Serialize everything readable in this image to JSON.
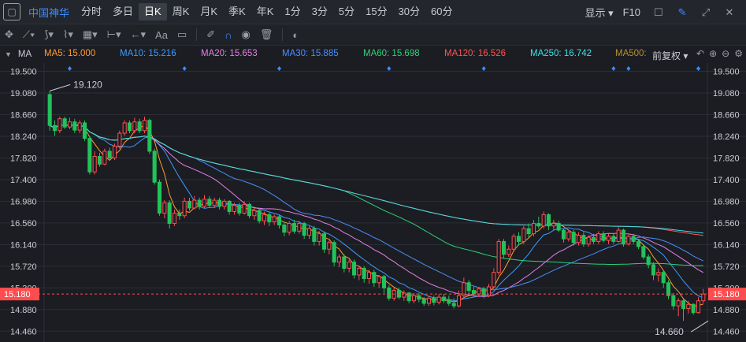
{
  "toolbar": {
    "back_icon": "square-back-icon",
    "stock_name": "中国神华",
    "periods": [
      {
        "label": "分时",
        "active": false
      },
      {
        "label": "多日",
        "active": false
      },
      {
        "label": "日K",
        "active": true
      },
      {
        "label": "周K",
        "active": false
      },
      {
        "label": "月K",
        "active": false
      },
      {
        "label": "季K",
        "active": false
      },
      {
        "label": "年K",
        "active": false
      },
      {
        "label": "1分",
        "active": false
      },
      {
        "label": "3分",
        "active": false
      },
      {
        "label": "5分",
        "active": false
      },
      {
        "label": "15分",
        "active": false
      },
      {
        "label": "30分",
        "active": false
      },
      {
        "label": "60分",
        "active": false
      }
    ],
    "display_label": "显示",
    "f10_label": "F10"
  },
  "drawing_tools": {
    "text_tool": "Aa"
  },
  "legend": {
    "ma_label": "MA",
    "adjust_label": "前复权",
    "items": [
      {
        "text": "MA5: 15.000",
        "color": "#ff9b2f",
        "x": 56
      },
      {
        "text": "MA10: 15.216",
        "color": "#3d9bff",
        "x": 152
      },
      {
        "text": "MA20: 15.653",
        "color": "#e77fe6",
        "x": 255
      },
      {
        "text": "MA30: 15.885",
        "color": "#4a8dff",
        "x": 358
      },
      {
        "text": "MA60: 15.698",
        "color": "#2fd07a",
        "x": 461
      },
      {
        "text": "MA120: 16.526",
        "color": "#ff5454",
        "x": 564
      },
      {
        "text": "MA250: 16.742",
        "color": "#3de0e6",
        "x": 673
      },
      {
        "text": "MA500:",
        "color": "#b8902c",
        "x": 781
      }
    ]
  },
  "colors": {
    "up": "#ff4d4f",
    "down": "#22c25a",
    "grid": "#2b2e35",
    "axis_text": "#c9ccd2",
    "current_price_bg": "#ff4d4f"
  },
  "chart_data": {
    "type": "candlestick",
    "ylim": [
      14.25,
      19.6
    ],
    "y_ticks": [
      19.5,
      19.08,
      18.66,
      18.24,
      17.82,
      17.4,
      16.98,
      16.56,
      16.14,
      15.72,
      15.3,
      14.88,
      14.46
    ],
    "y_tick_labels": [
      "19.500",
      "19.080",
      "18.660",
      "18.240",
      "17.820",
      "17.400",
      "16.980",
      "16.560",
      "16.140",
      "15.720",
      "15.300",
      "14.880",
      "14.460"
    ],
    "current_price": 15.18,
    "current_price_label": "15.180",
    "annotations": [
      {
        "text": "19.120",
        "price": 19.12,
        "index": 0
      },
      {
        "text": "14.660",
        "price": 14.66,
        "index": 132
      }
    ],
    "candles": [
      [
        19.05,
        18.45,
        19.12,
        18.35
      ],
      [
        18.45,
        18.35,
        18.55,
        18.25
      ],
      [
        18.35,
        18.58,
        18.62,
        18.3
      ],
      [
        18.58,
        18.42,
        18.62,
        18.38
      ],
      [
        18.42,
        18.52,
        18.6,
        18.38
      ],
      [
        18.52,
        18.36,
        18.58,
        18.3
      ],
      [
        18.36,
        18.5,
        18.55,
        18.3
      ],
      [
        18.5,
        18.2,
        18.55,
        18.15
      ],
      [
        18.2,
        17.55,
        18.25,
        17.5
      ],
      [
        17.55,
        17.85,
        17.95,
        17.5
      ],
      [
        17.85,
        17.7,
        17.92,
        17.65
      ],
      [
        17.7,
        17.95,
        18.0,
        17.68
      ],
      [
        17.95,
        17.82,
        18.02,
        17.78
      ],
      [
        17.82,
        18.05,
        18.1,
        17.78
      ],
      [
        18.05,
        18.3,
        18.35,
        18.0
      ],
      [
        18.3,
        18.5,
        18.55,
        18.25
      ],
      [
        18.5,
        18.35,
        18.55,
        18.3
      ],
      [
        18.35,
        18.52,
        18.6,
        18.3
      ],
      [
        18.52,
        18.35,
        18.58,
        18.3
      ],
      [
        18.35,
        18.55,
        18.62,
        18.3
      ],
      [
        18.55,
        17.95,
        18.58,
        17.9
      ],
      [
        17.95,
        17.35,
        18.0,
        17.3
      ],
      [
        17.35,
        16.75,
        17.4,
        16.7
      ],
      [
        16.75,
        16.95,
        17.0,
        16.65
      ],
      [
        16.95,
        16.55,
        17.0,
        16.45
      ],
      [
        16.55,
        16.75,
        16.82,
        16.5
      ],
      [
        16.75,
        16.7,
        16.82,
        16.62
      ],
      [
        16.7,
        16.98,
        17.05,
        16.65
      ],
      [
        16.98,
        16.85,
        17.05,
        16.8
      ],
      [
        16.85,
        17.0,
        17.08,
        16.82
      ],
      [
        17.0,
        16.88,
        17.05,
        16.82
      ],
      [
        16.88,
        17.02,
        17.1,
        16.85
      ],
      [
        17.02,
        16.9,
        17.08,
        16.85
      ],
      [
        16.9,
        17.0,
        17.05,
        16.85
      ],
      [
        17.0,
        16.88,
        17.05,
        16.82
      ],
      [
        16.88,
        16.98,
        17.02,
        16.82
      ],
      [
        16.98,
        16.78,
        17.0,
        16.72
      ],
      [
        16.78,
        16.9,
        16.95,
        16.72
      ],
      [
        16.9,
        16.75,
        16.95,
        16.7
      ],
      [
        16.75,
        16.92,
        16.98,
        16.72
      ],
      [
        16.92,
        16.7,
        16.95,
        16.65
      ],
      [
        16.7,
        16.8,
        16.85,
        16.62
      ],
      [
        16.8,
        16.6,
        16.85,
        16.55
      ],
      [
        16.6,
        16.72,
        16.78,
        16.52
      ],
      [
        16.72,
        16.58,
        16.78,
        16.5
      ],
      [
        16.58,
        16.68,
        16.72,
        16.52
      ],
      [
        16.68,
        16.52,
        16.72,
        16.45
      ],
      [
        16.52,
        16.38,
        16.58,
        16.3
      ],
      [
        16.38,
        16.55,
        16.6,
        16.32
      ],
      [
        16.55,
        16.4,
        16.62,
        16.35
      ],
      [
        16.4,
        16.55,
        16.6,
        16.35
      ],
      [
        16.55,
        16.32,
        16.58,
        16.25
      ],
      [
        16.32,
        16.45,
        16.5,
        16.25
      ],
      [
        16.45,
        16.2,
        16.5,
        16.12
      ],
      [
        16.2,
        16.35,
        16.4,
        16.12
      ],
      [
        16.35,
        16.05,
        16.4,
        15.98
      ],
      [
        16.05,
        16.18,
        16.22,
        15.95
      ],
      [
        16.18,
        15.8,
        16.22,
        15.72
      ],
      [
        15.8,
        15.9,
        15.95,
        15.7
      ],
      [
        15.9,
        15.68,
        15.95,
        15.6
      ],
      [
        15.68,
        15.8,
        15.85,
        15.6
      ],
      [
        15.8,
        15.55,
        15.85,
        15.48
      ],
      [
        15.55,
        15.68,
        15.72,
        15.45
      ],
      [
        15.68,
        15.48,
        15.72,
        15.4
      ],
      [
        15.48,
        15.6,
        15.65,
        15.38
      ],
      [
        15.6,
        15.4,
        15.65,
        15.32
      ],
      [
        15.4,
        15.52,
        15.55,
        15.3
      ],
      [
        15.52,
        15.3,
        15.55,
        15.2
      ],
      [
        15.3,
        15.1,
        15.35,
        15.05
      ],
      [
        15.1,
        15.25,
        15.3,
        15.05
      ],
      [
        15.25,
        15.12,
        15.3,
        15.08
      ],
      [
        15.12,
        15.2,
        15.25,
        15.05
      ],
      [
        15.2,
        15.05,
        15.22,
        15.0
      ],
      [
        15.05,
        15.15,
        15.2,
        15.0
      ],
      [
        15.15,
        15.08,
        15.2,
        15.02
      ],
      [
        15.08,
        15.0,
        15.12,
        14.95
      ],
      [
        15.0,
        15.1,
        15.15,
        14.95
      ],
      [
        15.1,
        15.02,
        15.15,
        14.96
      ],
      [
        15.02,
        15.12,
        15.18,
        14.98
      ],
      [
        15.12,
        15.05,
        15.18,
        15.0
      ],
      [
        15.05,
        15.0,
        15.15,
        14.95
      ],
      [
        15.0,
        14.95,
        15.1,
        14.9
      ],
      [
        14.95,
        15.15,
        15.25,
        14.92
      ],
      [
        15.15,
        15.4,
        15.5,
        15.1
      ],
      [
        15.4,
        15.25,
        15.45,
        15.18
      ],
      [
        15.25,
        15.18,
        15.32,
        15.12
      ],
      [
        15.18,
        15.28,
        15.32,
        15.12
      ],
      [
        15.28,
        15.15,
        15.32,
        15.1
      ],
      [
        15.15,
        15.32,
        15.38,
        15.12
      ],
      [
        15.32,
        15.6,
        15.68,
        15.28
      ],
      [
        15.6,
        16.2,
        16.25,
        15.55
      ],
      [
        16.2,
        15.95,
        16.25,
        15.88
      ],
      [
        15.95,
        16.05,
        16.12,
        15.9
      ],
      [
        16.05,
        16.3,
        16.35,
        16.0
      ],
      [
        16.3,
        16.2,
        16.38,
        16.12
      ],
      [
        16.2,
        16.45,
        16.5,
        16.15
      ],
      [
        16.45,
        16.35,
        16.55,
        16.28
      ],
      [
        16.35,
        16.55,
        16.62,
        16.3
      ],
      [
        16.55,
        16.5,
        16.68,
        16.45
      ],
      [
        16.5,
        16.72,
        16.78,
        16.45
      ],
      [
        16.72,
        16.5,
        16.75,
        16.42
      ],
      [
        16.5,
        16.55,
        16.62,
        16.42
      ],
      [
        16.55,
        16.42,
        16.6,
        16.38
      ],
      [
        16.42,
        16.25,
        16.45,
        16.18
      ],
      [
        16.25,
        16.38,
        16.42,
        16.2
      ],
      [
        16.38,
        16.18,
        16.42,
        16.12
      ],
      [
        16.18,
        16.32,
        16.38,
        16.12
      ],
      [
        16.32,
        16.15,
        16.38,
        16.1
      ],
      [
        16.15,
        16.28,
        16.32,
        16.1
      ],
      [
        16.28,
        16.2,
        16.35,
        16.15
      ],
      [
        16.2,
        16.35,
        16.4,
        16.15
      ],
      [
        16.35,
        16.22,
        16.4,
        16.18
      ],
      [
        16.22,
        16.3,
        16.35,
        16.15
      ],
      [
        16.3,
        16.2,
        16.35,
        16.15
      ],
      [
        16.2,
        16.42,
        16.48,
        16.18
      ],
      [
        16.42,
        16.15,
        16.45,
        16.1
      ],
      [
        16.15,
        16.3,
        16.35,
        16.12
      ],
      [
        16.3,
        16.2,
        16.35,
        16.15
      ],
      [
        16.2,
        16.1,
        16.25,
        16.05
      ],
      [
        16.1,
        15.9,
        16.15,
        15.85
      ],
      [
        15.9,
        15.75,
        15.95,
        15.68
      ],
      [
        15.75,
        15.55,
        15.8,
        15.45
      ],
      [
        15.55,
        15.6,
        15.68,
        15.42
      ],
      [
        15.6,
        15.4,
        15.65,
        15.3
      ],
      [
        15.4,
        15.15,
        15.45,
        15.08
      ],
      [
        15.15,
        14.95,
        15.2,
        14.88
      ],
      [
        14.95,
        15.05,
        15.1,
        14.75
      ],
      [
        15.05,
        14.9,
        15.1,
        14.66
      ],
      [
        14.9,
        14.98,
        15.05,
        14.8
      ],
      [
        14.98,
        14.82,
        15.0,
        14.78
      ],
      [
        14.82,
        15.05,
        15.12,
        14.8
      ],
      [
        15.05,
        15.18,
        15.28,
        15.0
      ]
    ]
  }
}
